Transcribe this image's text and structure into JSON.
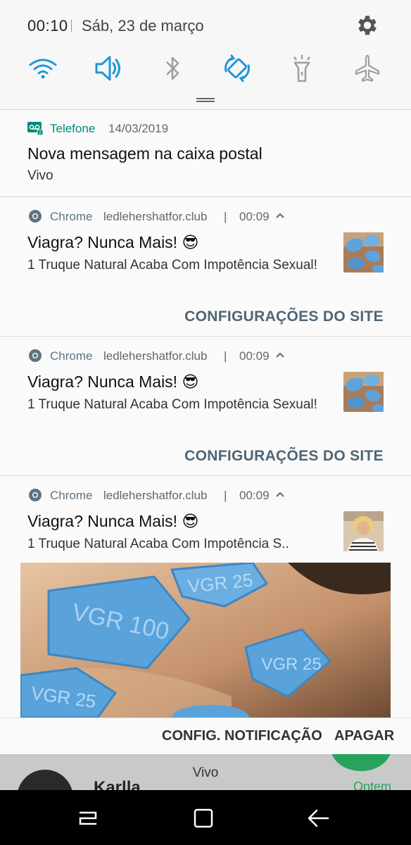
{
  "status": {
    "time": "00:10",
    "date": "Sáb, 23 de março"
  },
  "quick_settings": [
    "wifi-icon",
    "sound-icon",
    "bluetooth-icon",
    "auto-rotate-icon",
    "flashlight-icon",
    "airplane-mode-icon"
  ],
  "colors": {
    "accent": "#2196d9",
    "inactive": "#9e9e9e",
    "phone_teal": "#00897b",
    "site_button": "#4f6576"
  },
  "voicemail": {
    "app": "Telefone",
    "date": "14/03/2019",
    "title": "Nova mensagem na caixa postal",
    "body": "Vivo"
  },
  "notifications": [
    {
      "app": "Chrome",
      "site": "ledlehershatfor.club",
      "sep": "|",
      "time": "00:09",
      "title": "Viagra? Nunca Mais! 😎",
      "body": "1 Truque Natural Acaba Com Impotência Sexual!",
      "action": "CONFIGURAÇÕES DO SITE"
    },
    {
      "app": "Chrome",
      "site": "ledlehershatfor.club",
      "sep": "|",
      "time": "00:09",
      "title": "Viagra? Nunca Mais! 😎",
      "body": "1 Truque Natural Acaba Com Impotência Sexual!",
      "action": "CONFIGURAÇÕES DO SITE"
    },
    {
      "app": "Chrome",
      "site": "ledlehershatfor.club",
      "sep": "|",
      "time": "00:09",
      "title": "Viagra? Nunca Mais! 😎",
      "body": "1 Truque Natural Acaba Com Impotência S..",
      "pills": [
        "VGR 100",
        "VGR 25",
        "VGR 25",
        "VGR 25"
      ]
    }
  ],
  "actions": {
    "settings": "CONFIG. NOTIFICAÇÃO",
    "clear": "APAGAR"
  },
  "background_app": {
    "carrier": "Vivo",
    "contact": "Karlla",
    "time": "Ontem"
  }
}
